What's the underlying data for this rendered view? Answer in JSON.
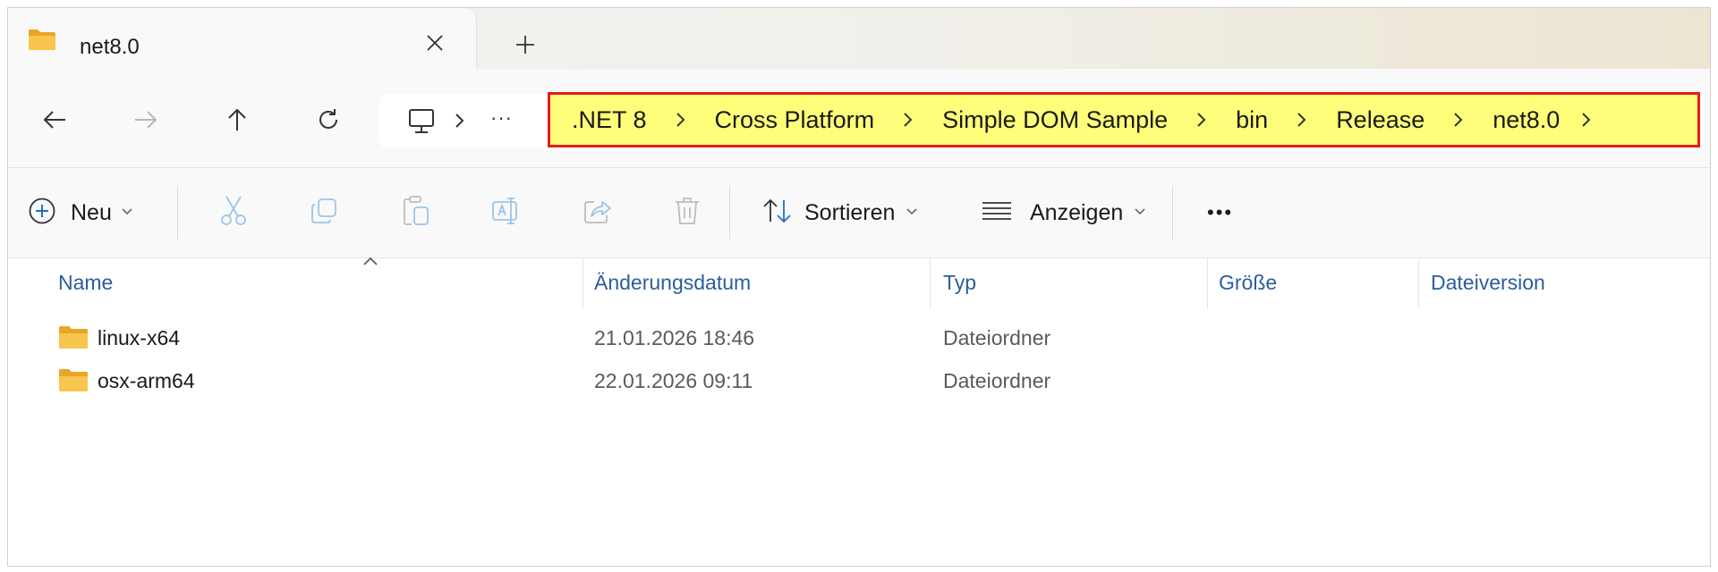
{
  "tab": {
    "title": "net8.0",
    "close_glyph": "✕",
    "new_tab_glyph": "+"
  },
  "nav": {
    "address": {
      "overflow_glyph": "···",
      "breadcrumbs": [
        ".NET 8",
        "Cross Platform",
        "Simple DOM Sample",
        "bin",
        "Release",
        "net8.0"
      ]
    }
  },
  "toolbar": {
    "new_label": "Neu",
    "sort_label": "Sortieren",
    "view_label": "Anzeigen",
    "more_glyph": "•••"
  },
  "list": {
    "columns": [
      "Name",
      "Änderungsdatum",
      "Typ",
      "Größe",
      "Dateiversion"
    ],
    "rows": [
      {
        "name": "linux-x64",
        "modified": "21.01.2026 18:46",
        "type": "Dateiordner",
        "size": "",
        "version": ""
      },
      {
        "name": "osx-arm64",
        "modified": "22.01.2026 09:11",
        "type": "Dateiordner",
        "size": "",
        "version": ""
      }
    ]
  },
  "colors": {
    "highlight_fill": "#fefe7a",
    "highlight_border": "#e41c1c",
    "header_text": "#2c5d9e",
    "folder": "#f4b83a"
  }
}
